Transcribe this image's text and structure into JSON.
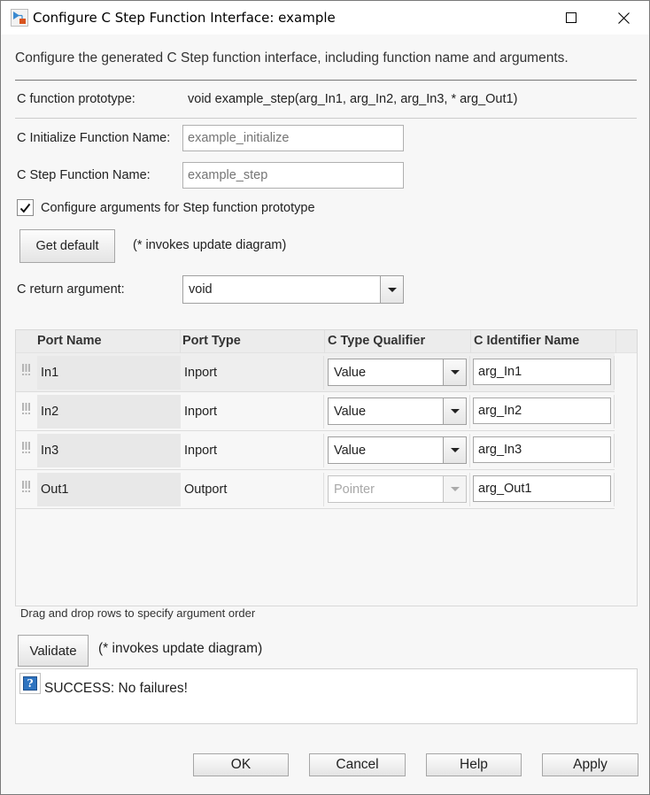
{
  "window": {
    "title": "Configure C Step Function Interface: example",
    "controls": {
      "minimize": "minimize-icon",
      "maximize": "maximize-icon",
      "close": "close-icon"
    }
  },
  "description": "Configure the generated C Step function interface, including function name and arguments.",
  "prototype": {
    "label": "C function prototype:",
    "value": "void example_step(arg_In1, arg_In2, arg_In3, * arg_Out1)"
  },
  "init_name": {
    "label": "C Initialize Function Name:",
    "value": "",
    "placeholder": "example_initialize"
  },
  "step_name": {
    "label": "C Step Function Name:",
    "value": "",
    "placeholder": "example_step"
  },
  "configure_args": {
    "label": "Configure arguments for Step function prototype",
    "checked": true
  },
  "get_default": {
    "label": "Get default",
    "note": "(* invokes update diagram)"
  },
  "return_arg": {
    "label": "C return argument:",
    "value": "void"
  },
  "table": {
    "columns": [
      "Port Name",
      "Port Type",
      "C Type Qualifier",
      "C Identifier Name"
    ],
    "rows": [
      {
        "port_name": "In1",
        "port_type": "Inport",
        "qualifier": "Value",
        "qualifier_enabled": true,
        "identifier": "arg_In1"
      },
      {
        "port_name": "In2",
        "port_type": "Inport",
        "qualifier": "Value",
        "qualifier_enabled": true,
        "identifier": "arg_In2"
      },
      {
        "port_name": "In3",
        "port_type": "Inport",
        "qualifier": "Value",
        "qualifier_enabled": true,
        "identifier": "arg_In3"
      },
      {
        "port_name": "Out1",
        "port_type": "Outport",
        "qualifier": "Pointer",
        "qualifier_enabled": false,
        "identifier": "arg_Out1"
      }
    ],
    "hint": "Drag and drop rows to specify argument order"
  },
  "validate": {
    "label": "Validate",
    "note": "(* invokes update diagram)"
  },
  "message": {
    "icon": "help-icon",
    "icon_glyph": "?",
    "text": "SUCCESS: No failures!"
  },
  "footer": {
    "ok": "OK",
    "cancel": "Cancel",
    "help": "Help",
    "apply": "Apply"
  }
}
